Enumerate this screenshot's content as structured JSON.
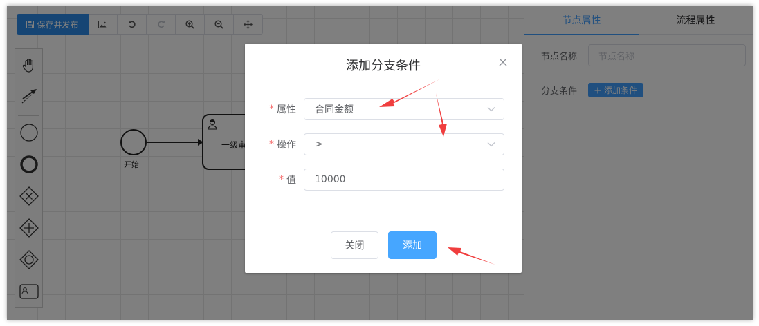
{
  "toolbar": {
    "publish_label": "保存并发布",
    "buttons": [
      "image-icon",
      "undo-icon",
      "redo-icon",
      "zoom-in-icon",
      "zoom-out-icon",
      "fit-view-icon"
    ]
  },
  "palette": {
    "items": [
      "hand-tool-icon",
      "connect-tool-icon",
      "start-event-icon",
      "end-event-icon",
      "exclusive-gateway-icon",
      "parallel-gateway-icon",
      "inclusive-gateway-icon",
      "user-task-icon"
    ]
  },
  "diagram": {
    "start_label": "开始",
    "task_label": "一级审"
  },
  "panel": {
    "tabs": [
      {
        "label": "节点属性",
        "active": true
      },
      {
        "label": "流程属性",
        "active": false
      }
    ],
    "node_name_label": "节点名称",
    "node_name_placeholder": "节点名称",
    "branch_condition_label": "分支条件",
    "add_condition_label": "添加条件"
  },
  "dialog": {
    "title": "添加分支条件",
    "fields": [
      {
        "label": "属性",
        "value": "合同金额",
        "required": true,
        "type": "select"
      },
      {
        "label": "操作",
        "value": ">",
        "required": true,
        "type": "select"
      },
      {
        "label": "值",
        "value": "10000",
        "required": true,
        "type": "input"
      }
    ],
    "required_mark": "*",
    "cancel_label": "关闭",
    "confirm_label": "添加"
  },
  "colors": {
    "primary": "#409eff",
    "publish_button": "#2c8be8",
    "annotation_arrow": "#f03e3e",
    "required_mark": "#f56c6c"
  }
}
